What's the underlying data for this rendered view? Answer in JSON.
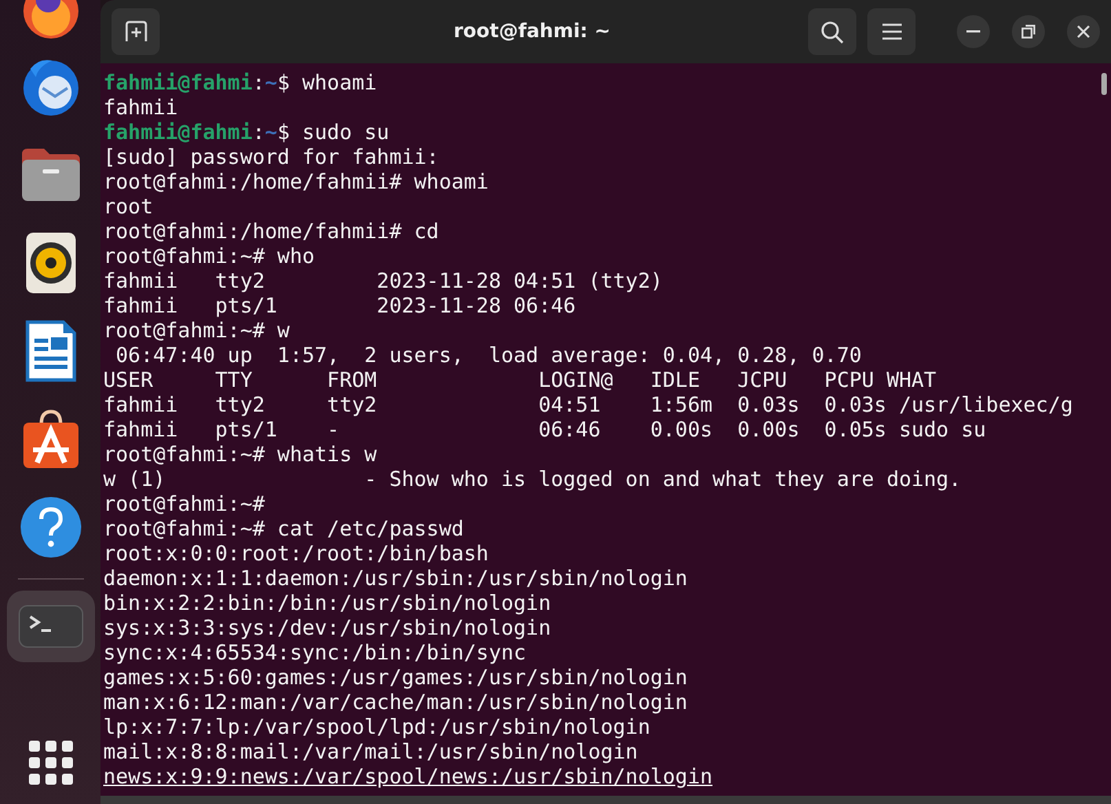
{
  "dock": {
    "items": [
      {
        "kind": "browser",
        "active": false
      },
      {
        "kind": "mail",
        "active": false
      },
      {
        "kind": "files",
        "active": false
      },
      {
        "kind": "music",
        "active": false
      },
      {
        "kind": "writer",
        "active": false
      },
      {
        "kind": "store",
        "active": false
      },
      {
        "kind": "help",
        "active": false
      },
      {
        "kind": "terminal",
        "active": true
      }
    ]
  },
  "window": {
    "title": "root@fahmi: ~"
  },
  "terminal": {
    "lines": [
      {
        "kind": "prompt",
        "user_host": "fahmii@fahmi",
        "separator": ":",
        "path": "~",
        "command": "$ whoami",
        "underlined": false
      },
      {
        "kind": "text",
        "text": "fahmii",
        "underlined": false
      },
      {
        "kind": "prompt",
        "user_host": "fahmii@fahmi",
        "separator": ":",
        "path": "~",
        "command": "$ sudo su",
        "underlined": false
      },
      {
        "kind": "text",
        "text": "[sudo] password for fahmii:",
        "underlined": false
      },
      {
        "kind": "text",
        "text": "root@fahmi:/home/fahmii# whoami",
        "underlined": false
      },
      {
        "kind": "text",
        "text": "root",
        "underlined": false
      },
      {
        "kind": "text",
        "text": "root@fahmi:/home/fahmii# cd",
        "underlined": false
      },
      {
        "kind": "text",
        "text": "root@fahmi:~# who",
        "underlined": false
      },
      {
        "kind": "text",
        "text": "fahmii   tty2         2023-11-28 04:51 (tty2)",
        "underlined": false
      },
      {
        "kind": "text",
        "text": "fahmii   pts/1        2023-11-28 06:46",
        "underlined": false
      },
      {
        "kind": "text",
        "text": "root@fahmi:~# w",
        "underlined": false
      },
      {
        "kind": "text",
        "text": " 06:47:40 up  1:57,  2 users,  load average: 0.04, 0.28, 0.70",
        "underlined": false
      },
      {
        "kind": "text",
        "text": "USER     TTY      FROM             LOGIN@   IDLE   JCPU   PCPU WHAT",
        "underlined": false
      },
      {
        "kind": "text",
        "text": "fahmii   tty2     tty2             04:51    1:56m  0.03s  0.03s /usr/libexec/g",
        "underlined": false
      },
      {
        "kind": "text",
        "text": "fahmii   pts/1    -                06:46    0.00s  0.00s  0.05s sudo su",
        "underlined": false
      },
      {
        "kind": "text",
        "text": "root@fahmi:~# whatis w",
        "underlined": false
      },
      {
        "kind": "text",
        "text": "w (1)                - Show who is logged on and what they are doing.",
        "underlined": false
      },
      {
        "kind": "text",
        "text": "root@fahmi:~#",
        "underlined": false
      },
      {
        "kind": "text",
        "text": "root@fahmi:~# cat /etc/passwd",
        "underlined": false
      },
      {
        "kind": "text",
        "text": "root:x:0:0:root:/root:/bin/bash",
        "underlined": false
      },
      {
        "kind": "text",
        "text": "daemon:x:1:1:daemon:/usr/sbin:/usr/sbin/nologin",
        "underlined": false
      },
      {
        "kind": "text",
        "text": "bin:x:2:2:bin:/bin:/usr/sbin/nologin",
        "underlined": false
      },
      {
        "kind": "text",
        "text": "sys:x:3:3:sys:/dev:/usr/sbin/nologin",
        "underlined": false
      },
      {
        "kind": "text",
        "text": "sync:x:4:65534:sync:/bin:/bin/sync",
        "underlined": false
      },
      {
        "kind": "text",
        "text": "games:x:5:60:games:/usr/games:/usr/sbin/nologin",
        "underlined": false
      },
      {
        "kind": "text",
        "text": "man:x:6:12:man:/var/cache/man:/usr/sbin/nologin",
        "underlined": false
      },
      {
        "kind": "text",
        "text": "lp:x:7:7:lp:/var/spool/lpd:/usr/sbin/nologin",
        "underlined": false
      },
      {
        "kind": "text",
        "text": "mail:x:8:8:mail:/var/mail:/usr/sbin/nologin",
        "underlined": false
      },
      {
        "kind": "text",
        "text": "news:x:9:9:news:/var/spool/news:/usr/sbin/nologin",
        "underlined": true
      }
    ]
  }
}
